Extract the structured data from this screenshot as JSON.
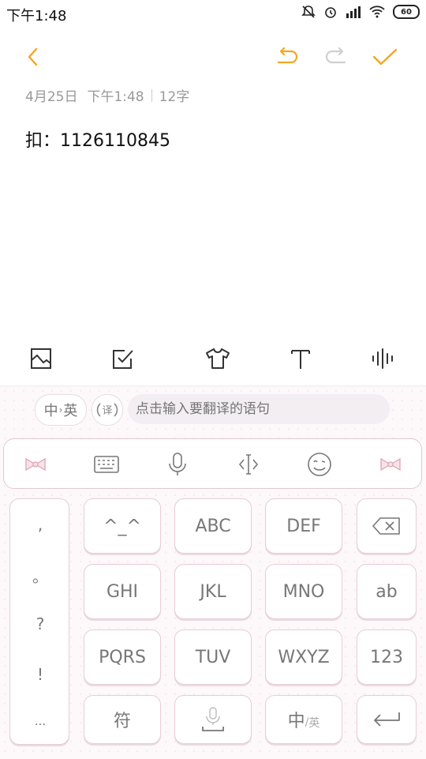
{
  "status": {
    "time": "下午1:48",
    "battery": "60"
  },
  "note": {
    "date": "4月25日",
    "time": "下午1:48",
    "count": "12字",
    "body": "扣：1126110845"
  },
  "keyboard": {
    "translate": {
      "zh": "中",
      "en": "英",
      "yi": "译",
      "placeholder": "点击输入要翻译的语句"
    },
    "punct": [
      ",",
      "。",
      "?",
      "!",
      "..."
    ],
    "keys": {
      "emoticon": "^_^",
      "abc": "ABC",
      "def": "DEF",
      "ghi": "GHI",
      "jkl": "JKL",
      "mno": "MNO",
      "ab": "ab",
      "pqrs": "PQRS",
      "tuv": "TUV",
      "wxyz": "WXYZ",
      "num": "123",
      "symbol": "符",
      "lang_zh": "中",
      "lang_en": "英"
    }
  },
  "colors": {
    "accent": "#f5a623",
    "kbd_border": "#e7cdd6"
  }
}
